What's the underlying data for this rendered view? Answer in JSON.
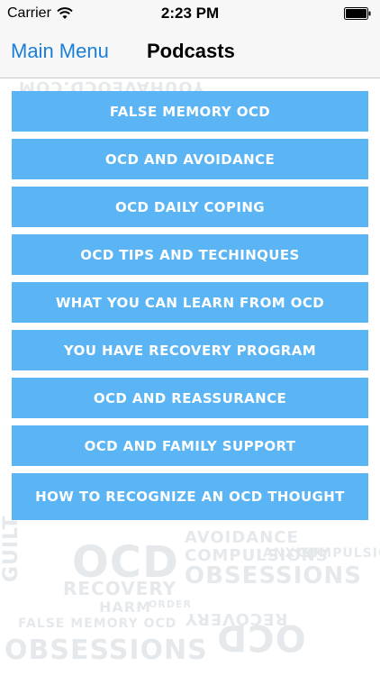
{
  "status_bar": {
    "carrier": "Carrier",
    "time": "2:23 PM"
  },
  "nav": {
    "back_label": "Main Menu",
    "title": "Podcasts"
  },
  "podcasts": [
    "FALSE MEMORY OCD",
    "OCD AND AVOIDANCE",
    "OCD DAILY COPING",
    "OCD TIPS AND TECHINQUES",
    "WHAT YOU CAN LEARN FROM OCD",
    "YOU HAVE RECOVERY PROGRAM",
    "OCD AND REASSURANCE",
    "OCD AND FAMILY SUPPORT",
    "HOW TO RECOGNIZE AN OCD THOUGHT"
  ],
  "background_words": [
    "YOUHAVEOCD.COM",
    "OCD",
    "AVOIDANCE",
    "COMPULSIONS",
    "OBSESSIONS",
    "RECOVERY",
    "HARM",
    "ORDER",
    "FALSE MEMORY OCD",
    "GUILT",
    "ANXIETY",
    "OBSESSIONS",
    "OCD",
    "RECOVERY",
    "COMPULSIONS"
  ],
  "colors": {
    "accent": "#1a7fd6",
    "button_bg": "#5bb4f4",
    "button_text": "#ffffff",
    "bar_bg": "#f7f7f7",
    "texture": "#e6e9ec"
  },
  "icons": {
    "wifi": "wifi-icon",
    "battery": "battery-icon"
  }
}
